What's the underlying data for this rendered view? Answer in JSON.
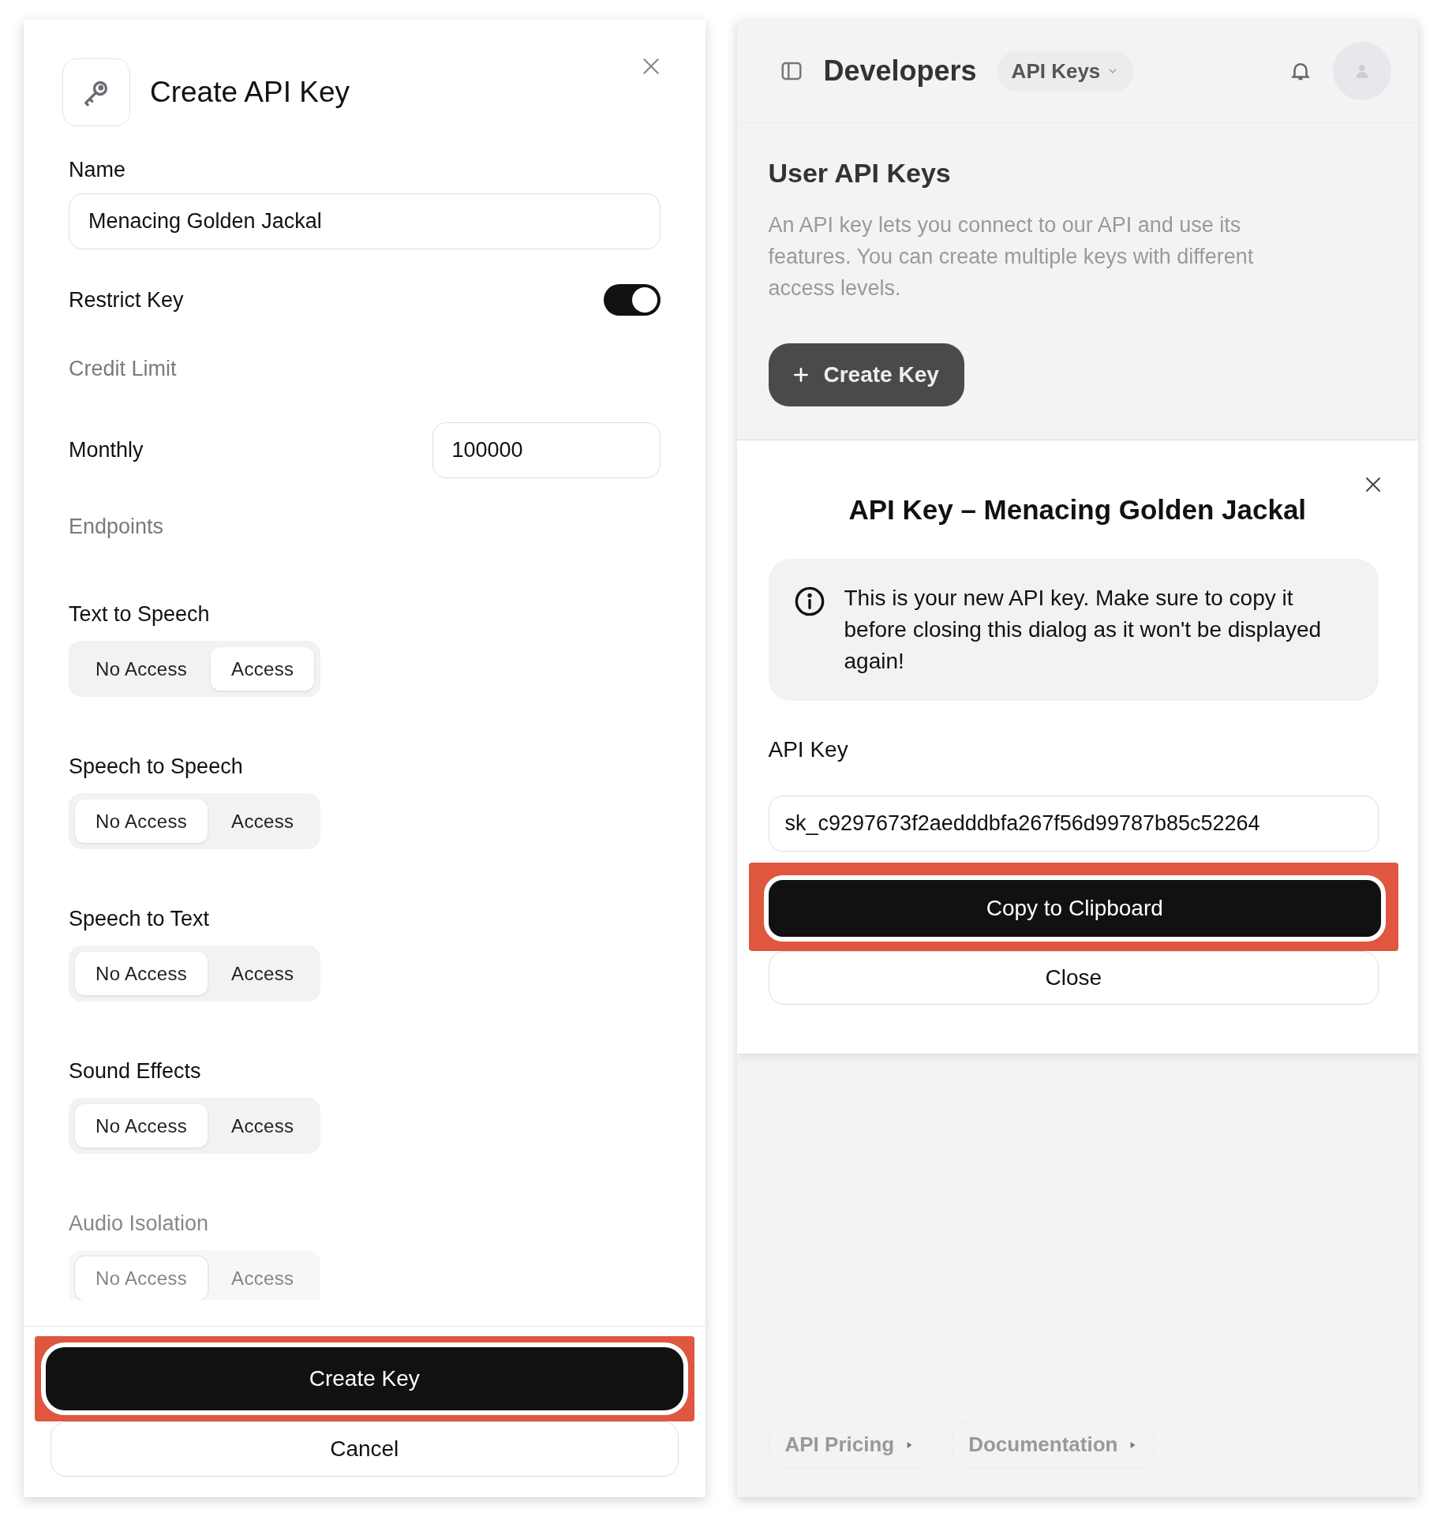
{
  "create_dialog": {
    "title": "Create API Key",
    "name_label": "Name",
    "name_value": "Menacing Golden Jackal",
    "restrict": {
      "label": "Restrict Key",
      "on": true
    },
    "credit_section": "Credit Limit",
    "monthly": {
      "label": "Monthly",
      "value": "100000"
    },
    "endpoints_section": "Endpoints",
    "endpoints": [
      {
        "name": "Text to Speech",
        "faded": false,
        "options": [
          {
            "label": "No Access",
            "selected": false
          },
          {
            "label": "Access",
            "selected": true
          }
        ]
      },
      {
        "name": "Speech to Speech",
        "faded": false,
        "options": [
          {
            "label": "No Access",
            "selected": true
          },
          {
            "label": "Access",
            "selected": false
          }
        ]
      },
      {
        "name": "Speech to Text",
        "faded": false,
        "options": [
          {
            "label": "No Access",
            "selected": true
          },
          {
            "label": "Access",
            "selected": false
          }
        ]
      },
      {
        "name": "Sound Effects",
        "faded": false,
        "options": [
          {
            "label": "No Access",
            "selected": true
          },
          {
            "label": "Access",
            "selected": false
          }
        ]
      },
      {
        "name": "Audio Isolation",
        "faded": true,
        "options": [
          {
            "label": "No Access",
            "selected": true
          },
          {
            "label": "Access",
            "selected": false
          }
        ]
      }
    ],
    "primary_button": "Create Key",
    "primary_highlighted": true,
    "secondary_button": "Cancel"
  },
  "background_page": {
    "header_title": "Developers",
    "header_dropdown": "API Keys",
    "heading": "User API Keys",
    "description": "An API key lets you connect to our API and use its features. You can create multiple keys with different access levels.",
    "create_button": "Create Key",
    "footer_links": [
      "API Pricing",
      "Documentation"
    ]
  },
  "key_dialog": {
    "title": "API Key – Menacing Golden Jackal",
    "notice": "This is your new API key. Make sure to copy it before closing this dialog as it won't be displayed again!",
    "key_label": "API Key",
    "key_value": "sk_c9297673f2aedddbfa267f56d99787b85c52264",
    "primary_button": "Copy to Clipboard",
    "primary_highlighted": true,
    "secondary_button": "Close"
  }
}
